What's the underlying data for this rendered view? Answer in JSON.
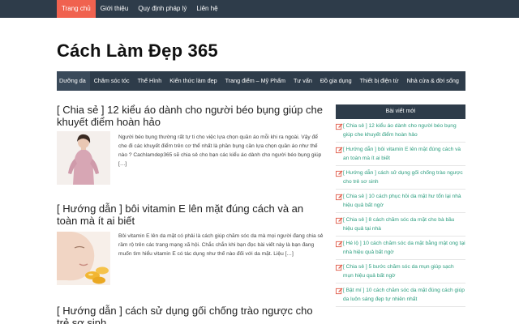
{
  "topnav": {
    "items": [
      "Trang chủ",
      "Giới thiệu",
      "Quy định pháp lý",
      "Liên hệ"
    ]
  },
  "site": {
    "title": "Cách Làm Đẹp 365"
  },
  "mainnav": {
    "items": [
      "Dưỡng da",
      "Chăm sóc tóc",
      "Thể Hình",
      "Kiến thức làm đẹp",
      "Trang điểm – Mỹ Phẩm",
      "Tư vấn",
      "Đồ gia dụng",
      "Thiết bị điện tử",
      "Nhà cửa & đời sống"
    ]
  },
  "posts": [
    {
      "title": "[ Chia sẻ ] 12 kiểu áo dành cho người béo bụng giúp che khuyết điểm hoàn hảo",
      "excerpt": "Người béo bụng thường rất tự ti cho việc lựa chọn quần áo mỗi khi ra ngoài. Vậy để che đi các khuyết điểm trên cơ thể nhất là phần bụng cần lựa chọn quần áo như thế nào ? Cachlamdep365 sẽ chia sẻ cho bạn các kiểu áo dành cho người béo bụng giúp […]"
    },
    {
      "title": "[ Hướng dẫn ] bôi vitamin E lên mặt đúng cách và an toàn mà ít ai biết",
      "excerpt": "Bôi vitamin E lên da mặt có phải là cách giúp chăm sóc da mà mọi người đang chia sẻ rầm rộ trên các trang mạng xã hội. Chắc chắn khi bạn đọc bài viết này là bạn đang muốn tìm hiểu vitamin E có tác dụng như thế nào đối với da mặt. Liệu […]"
    },
    {
      "title": "[ Hướng dẫn ] cách sử dụng gối chống trào ngược cho trẻ sơ sinh"
    }
  ],
  "sidebar": {
    "heading": "Bài viết mới",
    "items": [
      "[ Chia sẻ ] 12 kiểu áo dành cho người béo bụng giúp che khuyết điểm hoàn hảo",
      "[ Hướng dẫn ] bôi vitamin E lên mặt đúng cách và an toàn mà ít ai biết",
      "[ Hướng dẫn ] cách sử dụng gối chống trào ngược cho trẻ sơ sinh",
      "[ Chia sẻ ] 10 cách phục hồi da mặt hư tổn lại nhà hiệu quả bất ngờ",
      "[ Chia sẻ ] 8 cách chăm sóc da mặt cho bà bầu hiệu quả tại nhà",
      "[ Hé lộ ] 10 cách chăm sóc da mặt bằng mật ong tại nhà hiệu quả bất ngờ",
      "[ Chia sẻ ] 5 bước chăm sóc da mụn giúp sạch mụn hiệu quả bất ngờ",
      "[ Bật mí ] 10 cách chăm sóc da mặt đúng cách giúp da luôn sáng đẹp tự nhiên nhất"
    ]
  },
  "colors": {
    "nav_bg": "#2e3c4a",
    "accent": "#f0624f",
    "link": "#2a9d7e"
  }
}
